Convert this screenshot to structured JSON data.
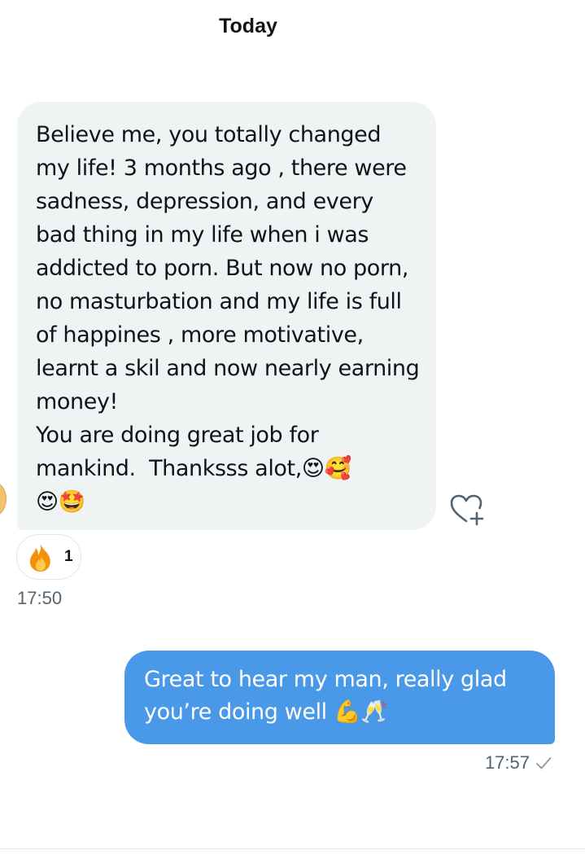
{
  "conversation": {
    "date_header": "Today",
    "messages": [
      {
        "direction": "incoming",
        "text": "Believe me, you totally changed my life! 3 months ago , there were sadness, depression, and every bad thing in my life when i was addicted to porn. But now no porn, no masturbation and my life is full of happines , more motivative, learnt a skil and now nearly earning money!\nYou are doing great job for mankind.  Thanksss alot,😍🥰\n😍🤩",
        "time": "17:50",
        "reaction": {
          "emoji_icon": "fire-icon",
          "count": "1"
        }
      },
      {
        "direction": "outgoing",
        "text": "Great to hear my man, really glad you’re doing well 💪🥂",
        "time": "17:57",
        "status_icon": "check-icon"
      }
    ]
  },
  "colors": {
    "incoming_bubble": "#eff3f4",
    "outgoing_bubble": "#4a99e9",
    "timestamp": "#536471",
    "text": "#0f1419"
  }
}
